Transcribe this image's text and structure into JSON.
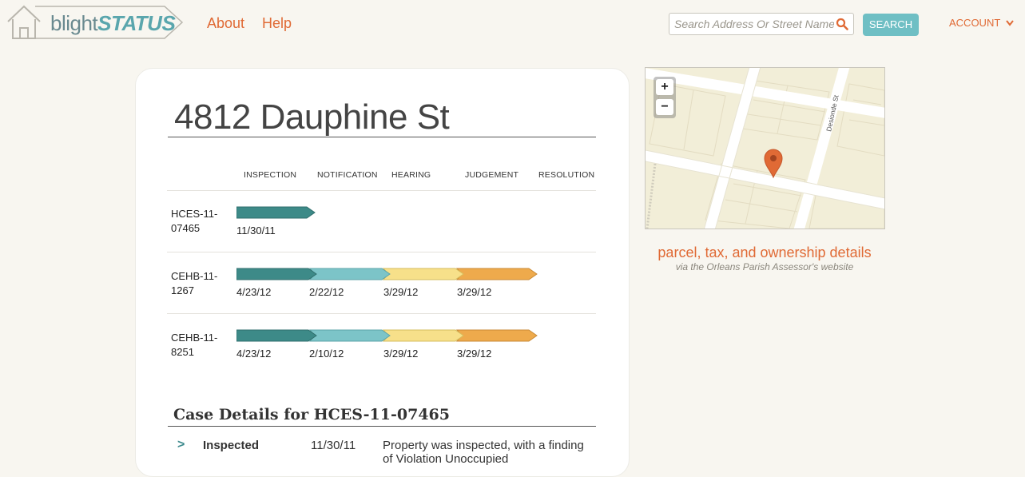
{
  "brand": {
    "name_part1": "blight",
    "name_part2": "STATUS"
  },
  "nav": {
    "about": "About",
    "help": "Help",
    "account": "ACCOUNT"
  },
  "search": {
    "placeholder": "Search Address Or Street Name",
    "button": "SEARCH"
  },
  "property": {
    "address": "4812 Dauphine St"
  },
  "timeline": {
    "stages": [
      "INSPECTION",
      "NOTIFICATION",
      "HEARING",
      "JUDGEMENT",
      "RESOLUTION"
    ],
    "cases": [
      {
        "id_line1": "HCES-11-",
        "id_line2": "07465",
        "dates": [
          "11/30/11"
        ]
      },
      {
        "id_line1": "CEHB-11-",
        "id_line2": "1267",
        "dates": [
          "4/23/12",
          "2/22/12",
          "3/29/12",
          "3/29/12"
        ]
      },
      {
        "id_line1": "CEHB-11-",
        "id_line2": "8251",
        "dates": [
          "4/23/12",
          "2/10/12",
          "3/29/12",
          "3/29/12"
        ]
      }
    ],
    "colors": [
      "#3d8a88",
      "#7cc4c8",
      "#f7e08a",
      "#eeaa4c"
    ]
  },
  "details": {
    "title": "Case Details for HCES-11-07465",
    "rows": [
      {
        "status": "Inspected",
        "date": "11/30/11",
        "desc": "Property was inspected, with a finding of Violation Unoccupied"
      }
    ]
  },
  "map": {
    "street_label": "Desionde St",
    "zoom_in": "+",
    "zoom_out": "−",
    "marker_color": "#e06a35"
  },
  "assessor": {
    "link": "parcel, tax, and ownership details",
    "sub": "via the Orleans Parish Assessor's website"
  }
}
